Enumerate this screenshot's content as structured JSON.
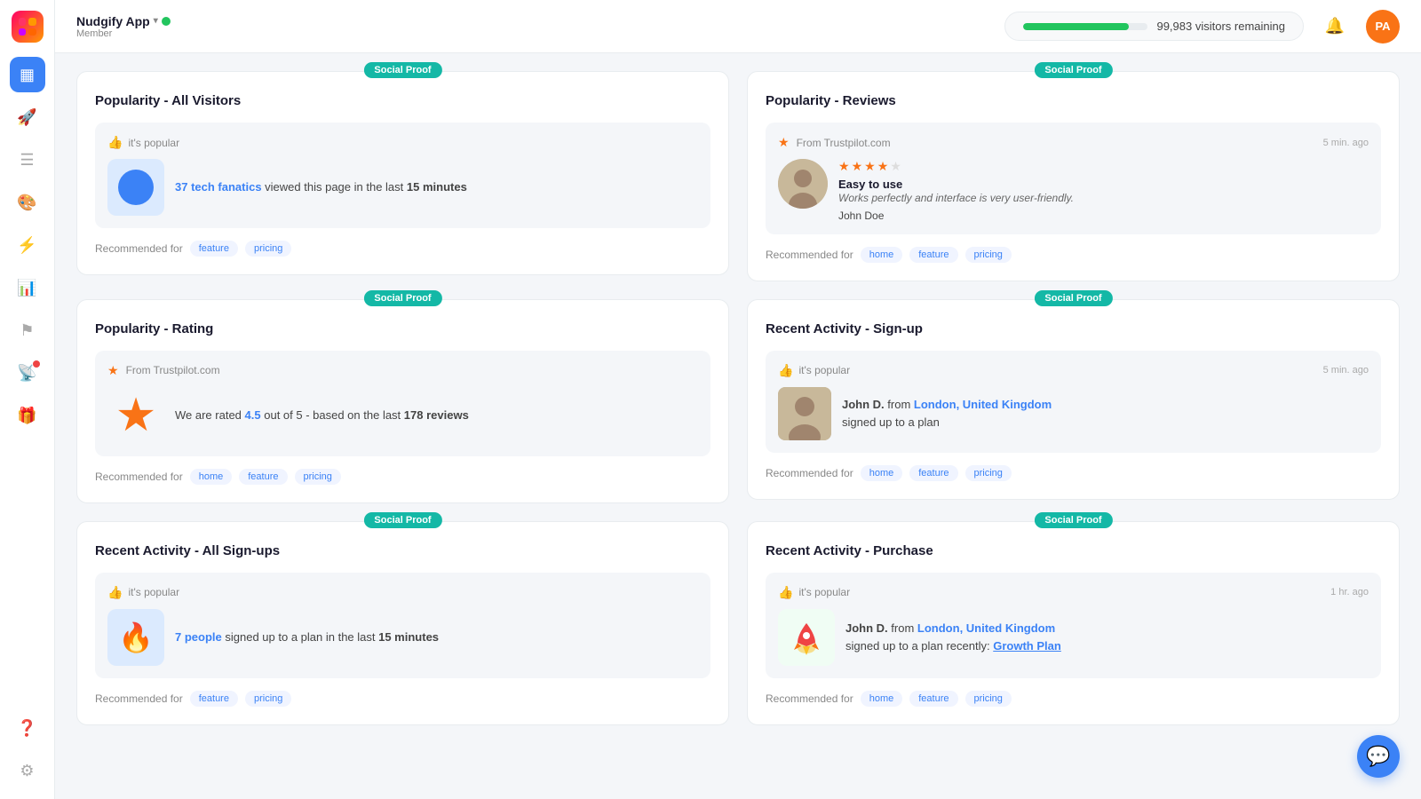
{
  "app": {
    "name": "Nudgify App",
    "dropdown_icon": "▾",
    "sub": "Member",
    "status": "active"
  },
  "header": {
    "visitors_label": "99,983 visitors remaining",
    "progress_percent": 85,
    "bell_icon": "🔔",
    "avatar_initials": "PA"
  },
  "sidebar": {
    "items": [
      {
        "icon": "🚀",
        "name": "launch",
        "active": false
      },
      {
        "icon": "▦",
        "name": "dashboard",
        "active": true
      },
      {
        "icon": "☰",
        "name": "notifications",
        "active": false
      },
      {
        "icon": "🎨",
        "name": "themes",
        "active": false
      },
      {
        "icon": "⚡",
        "name": "activity",
        "active": false
      },
      {
        "icon": "📊",
        "name": "analytics",
        "active": false
      },
      {
        "icon": "⚑",
        "name": "goals",
        "active": false
      },
      {
        "icon": "📡",
        "name": "live",
        "active": false,
        "has_dot": true
      },
      {
        "icon": "🎁",
        "name": "gifts",
        "active": false
      }
    ],
    "bottom": [
      {
        "icon": "❓",
        "name": "help"
      },
      {
        "icon": "⚙",
        "name": "settings"
      }
    ]
  },
  "cards": [
    {
      "id": "popularity-all-visitors",
      "badge": "Social Proof",
      "title": "Popularity - All Visitors",
      "preview": {
        "type": "visitors",
        "popular_label": "it's popular",
        "count_highlight": "37 tech fanatics",
        "text": "viewed this page in the last",
        "time_bold": "15 minutes"
      },
      "recommended_for": [
        "feature",
        "pricing"
      ]
    },
    {
      "id": "popularity-reviews",
      "badge": "Social Proof",
      "title": "Popularity - Reviews",
      "preview": {
        "type": "review",
        "source": "From Trustpilot.com",
        "time": "5 min. ago",
        "stars": 4,
        "title": "Easy to use",
        "body": "Works perfectly and interface is very user-friendly.",
        "author": "John Doe"
      },
      "recommended_for": [
        "home",
        "feature",
        "pricing"
      ]
    },
    {
      "id": "popularity-rating",
      "badge": "Social Proof",
      "title": "Popularity - Rating",
      "preview": {
        "type": "rating",
        "source": "From Trustpilot.com",
        "rating_highlight": "4.5",
        "text_before": "We are rated",
        "text_after": "out of 5 - based on the last",
        "reviews_bold": "178 reviews"
      },
      "recommended_for": [
        "home",
        "feature",
        "pricing"
      ]
    },
    {
      "id": "recent-activity-signup",
      "badge": "Social Proof",
      "title": "Recent Activity - Sign-up",
      "preview": {
        "type": "signup",
        "popular_label": "it's popular",
        "time": "5 min. ago",
        "name": "John D.",
        "from_label": "from",
        "location_highlight": "London, United Kingdom",
        "action": "signed up to a plan"
      },
      "recommended_for": [
        "home",
        "feature",
        "pricing"
      ]
    },
    {
      "id": "recent-activity-all-signups",
      "badge": "Social Proof",
      "title": "Recent Activity - All Sign-ups",
      "preview": {
        "type": "all-signups",
        "popular_label": "it's popular",
        "count_highlight": "7 people",
        "text": "signed up to a plan in the last",
        "time_bold": "15 minutes"
      },
      "recommended_for": [
        "feature",
        "pricing"
      ]
    },
    {
      "id": "recent-activity-purchase",
      "badge": "Social Proof",
      "title": "Recent Activity - Purchase",
      "preview": {
        "type": "purchase",
        "popular_label": "it's popular",
        "time": "1 hr. ago",
        "name": "John D.",
        "from_label": "from",
        "location_highlight": "London, United Kingdom",
        "action": "signed up to a plan recently:",
        "plan_link": "Growth Plan"
      },
      "recommended_for": [
        "home",
        "feature",
        "pricing"
      ]
    }
  ],
  "chat_button": "💬"
}
